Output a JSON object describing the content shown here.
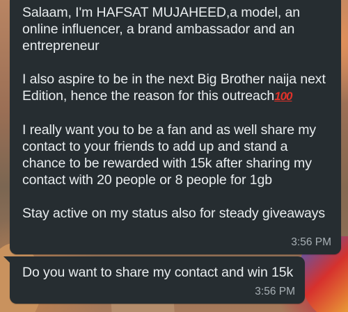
{
  "messages": [
    {
      "paragraphs": [
        "Salaam, I'm HAFSAT MUJAHEED,a model, an online influencer, a brand ambassador and an entrepreneur",
        "I also aspire to be in the next Big Brother naija next Edition, hence the reason for this outreach",
        "I really want you to be a fan and as well share my contact to your friends to add up and stand a chance to be rewarded with 15k after sharing my contact with 20 people or 8 people for 1gb",
        "Stay active on my status also for steady giveaways"
      ],
      "emoji": "100",
      "emoji_name": "hundred-points-emoji",
      "time": "3:56 PM"
    },
    {
      "paragraphs": [
        "Do you want to share my contact and win 15k"
      ],
      "time": "3:56 PM"
    }
  ],
  "colors": {
    "bubble": "#262d31",
    "text": "#e9edef",
    "timestamp": "#a8b0b5",
    "emoji_red": "#e0322a"
  }
}
